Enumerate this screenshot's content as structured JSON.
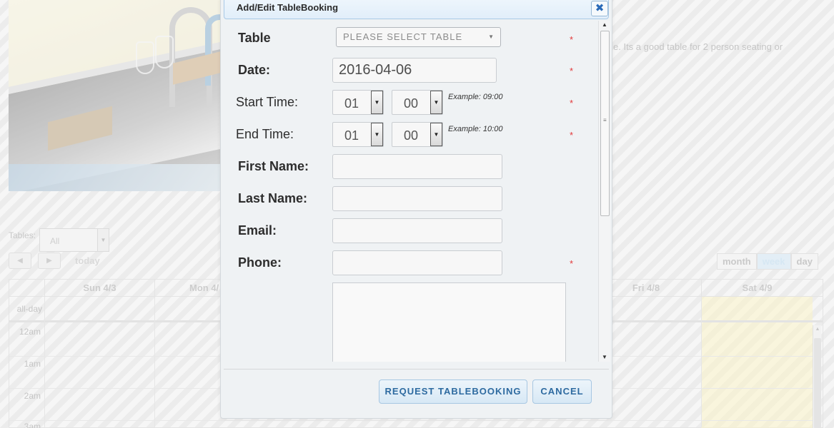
{
  "background": {
    "description_snippet": "e.  Its a good table for 2 person seating or",
    "tables_label": "Tables:",
    "tables_select_value": "All",
    "today_label": "today",
    "views": [
      "month",
      "week",
      "day"
    ],
    "active_view": "week",
    "calendar": {
      "days": [
        "Sun 4/3",
        "Mon 4/",
        "Fri 4/8",
        "Sat 4/9"
      ],
      "allday_label": "all-day",
      "hours": [
        "12am",
        "1am",
        "2am",
        "3am"
      ]
    }
  },
  "modal": {
    "title": "Add/Edit TableBooking",
    "close_glyph": "✖",
    "fields": {
      "table_label": "Table",
      "table_placeholder": "PLEASE SELECT TABLE",
      "date_label": "Date:",
      "date_value": "2016-04-06",
      "start_label": "Start Time:",
      "start_hour": "01",
      "start_minute": "00",
      "start_example": "Example: 09:00",
      "end_label": "End Time:",
      "end_hour": "01",
      "end_minute": "00",
      "end_example": "Example: 10:00",
      "first_name_label": "First Name:",
      "last_name_label": "Last Name:",
      "email_label": "Email:",
      "phone_label": "Phone:",
      "required_marker": "*"
    },
    "buttons": {
      "request": "REQUEST TABLEBOOKING",
      "cancel": "CANCEL"
    }
  },
  "colors": {
    "accent": "#2d6aa0",
    "required": "#e23a3a",
    "title_bar": "#e1eefa"
  }
}
